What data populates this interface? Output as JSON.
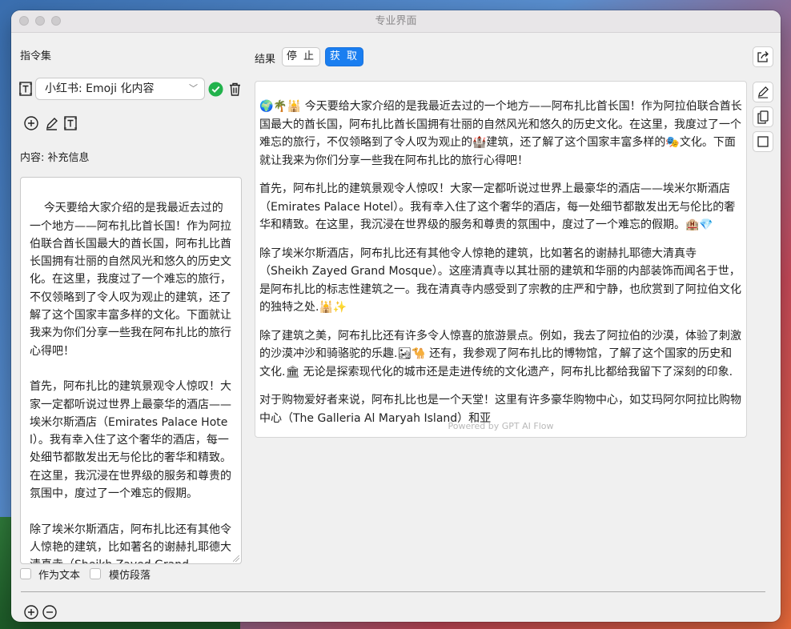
{
  "window": {
    "title": "专业界面"
  },
  "left": {
    "section_title": "指令集",
    "selected_instruction": "小红书: Emoji 化内容",
    "content_label": "内容: 补充信息",
    "input_text": "今天要给大家介绍的是我最近去过的一个地方——阿布扎比首长国！作为阿拉伯联合酋长国最大的酋长国，阿布扎比酋长国拥有壮丽的自然风光和悠久的历史文化。在这里，我度过了一个难忘的旅行，不仅领略到了令人叹为观止的建筑，还了解了这个国家丰富多样的文化。下面就让我来为你们分享一些我在阿布扎比的旅行心得吧！\n\n首先，阿布扎比的建筑景观令人惊叹！大家一定都听说过世界上最豪华的酒店——埃米尔斯酒店（Emirates Palace Hotel）。我有幸入住了这个奢华的酒店，每一处细节都散发出无与伦比的奢华和精致。在这里，我沉浸在世界级的服务和尊贵的氛围中，度过了一个难忘的假期。\n\n除了埃米尔斯酒店，阿布扎比还有其他令人惊艳的建筑，比如著名的谢赫扎耶德大清真寺（Sheikh Zayed Grand",
    "checkbox_as_text": "作为文本",
    "checkbox_imitate": "模仿段落"
  },
  "right": {
    "result_label": "结果",
    "stop_label": "停 止",
    "fetch_label": "获 取",
    "paragraphs": [
      "🌍🌴🕌 今天要给大家介绍的是我最近去过的一个地方——阿布扎比首长国！作为阿拉伯联合酋长国最大的酋长国，阿布扎比酋长国拥有壮丽的自然风光和悠久的历史文化。在这里，我度过了一个难忘的旅行，不仅领略到了令人叹为观止的🏰建筑，还了解了这个国家丰富多样的🎭文化。下面就让我来为你们分享一些我在阿布扎比的旅行心得吧！",
      "首先，阿布扎比的建筑景观令人惊叹！大家一定都听说过世界上最豪华的酒店——埃米尔斯酒店（Emirates Palace Hotel）。我有幸入住了这个奢华的酒店，每一处细节都散发出无与伦比的奢华和精致。在这里，我沉浸在世界级的服务和尊贵的氛围中，度过了一个难忘的假期。🏨💎",
      "除了埃米尔斯酒店，阿布扎比还有其他令人惊艳的建筑，比如著名的谢赫扎耶德大清真寺（Sheikh Zayed Grand Mosque）。这座清真寺以其壮丽的建筑和华丽的内部装饰而闻名于世，是阿布扎比的标志性建筑之一。我在清真寺内感受到了宗教的庄严和宁静，也欣赏到了阿拉伯文化的独特之处.🕌✨",
      "除了建筑之美，阿布扎比还有许多令人惊喜的旅游景点。例如，我去了阿拉伯的沙漠，体验了刺激的沙漠冲沙和骑骆驼的乐趣.🏜🐪 还有，我参观了阿布扎比的博物馆，了解了这个国家的历史和文化.🏛 无论是探索现代化的城市还是走进传统的文化遗产，阿布扎比都给我留下了深刻的印象.",
      "对于购物爱好者来说，阿布扎比也是一个天堂！这里有许多豪华购物中心，如艾玛阿尔阿拉比购物中心（The Galleria Al Maryah Island）和亚"
    ],
    "footer": "Powered by GPT AI Flow"
  },
  "icons": {
    "template": "text-template-icon",
    "confirm": "check-circle-icon",
    "delete": "trash-icon",
    "add": "plus-circle-icon",
    "edit": "pencil-icon",
    "share": "share-icon",
    "copy": "copy-icon",
    "square": "square-icon",
    "remove": "minus-circle-icon"
  },
  "colors": {
    "accent": "#1a7ef0",
    "success": "#22b24c"
  }
}
